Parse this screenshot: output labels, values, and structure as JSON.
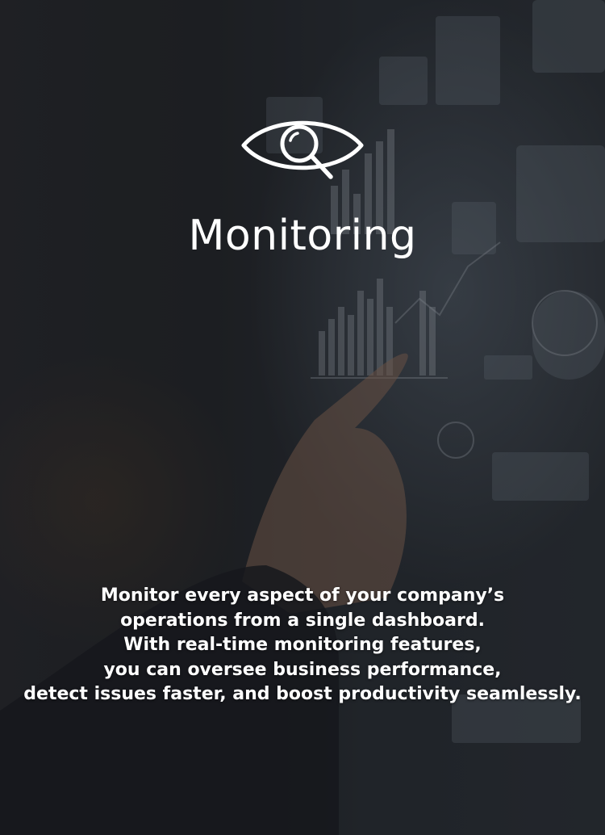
{
  "title": "Monitoring",
  "description_lines": [
    "Monitor every aspect of your company’s",
    "operations from a single dashboard.",
    "With real-time monitoring features,",
    "you can oversee business performance,",
    "detect issues faster, and boost productivity seamlessly."
  ],
  "icon": "eye-with-magnifier-icon",
  "colors": {
    "text": "#ffffff",
    "overlay": "#0c0e12"
  }
}
